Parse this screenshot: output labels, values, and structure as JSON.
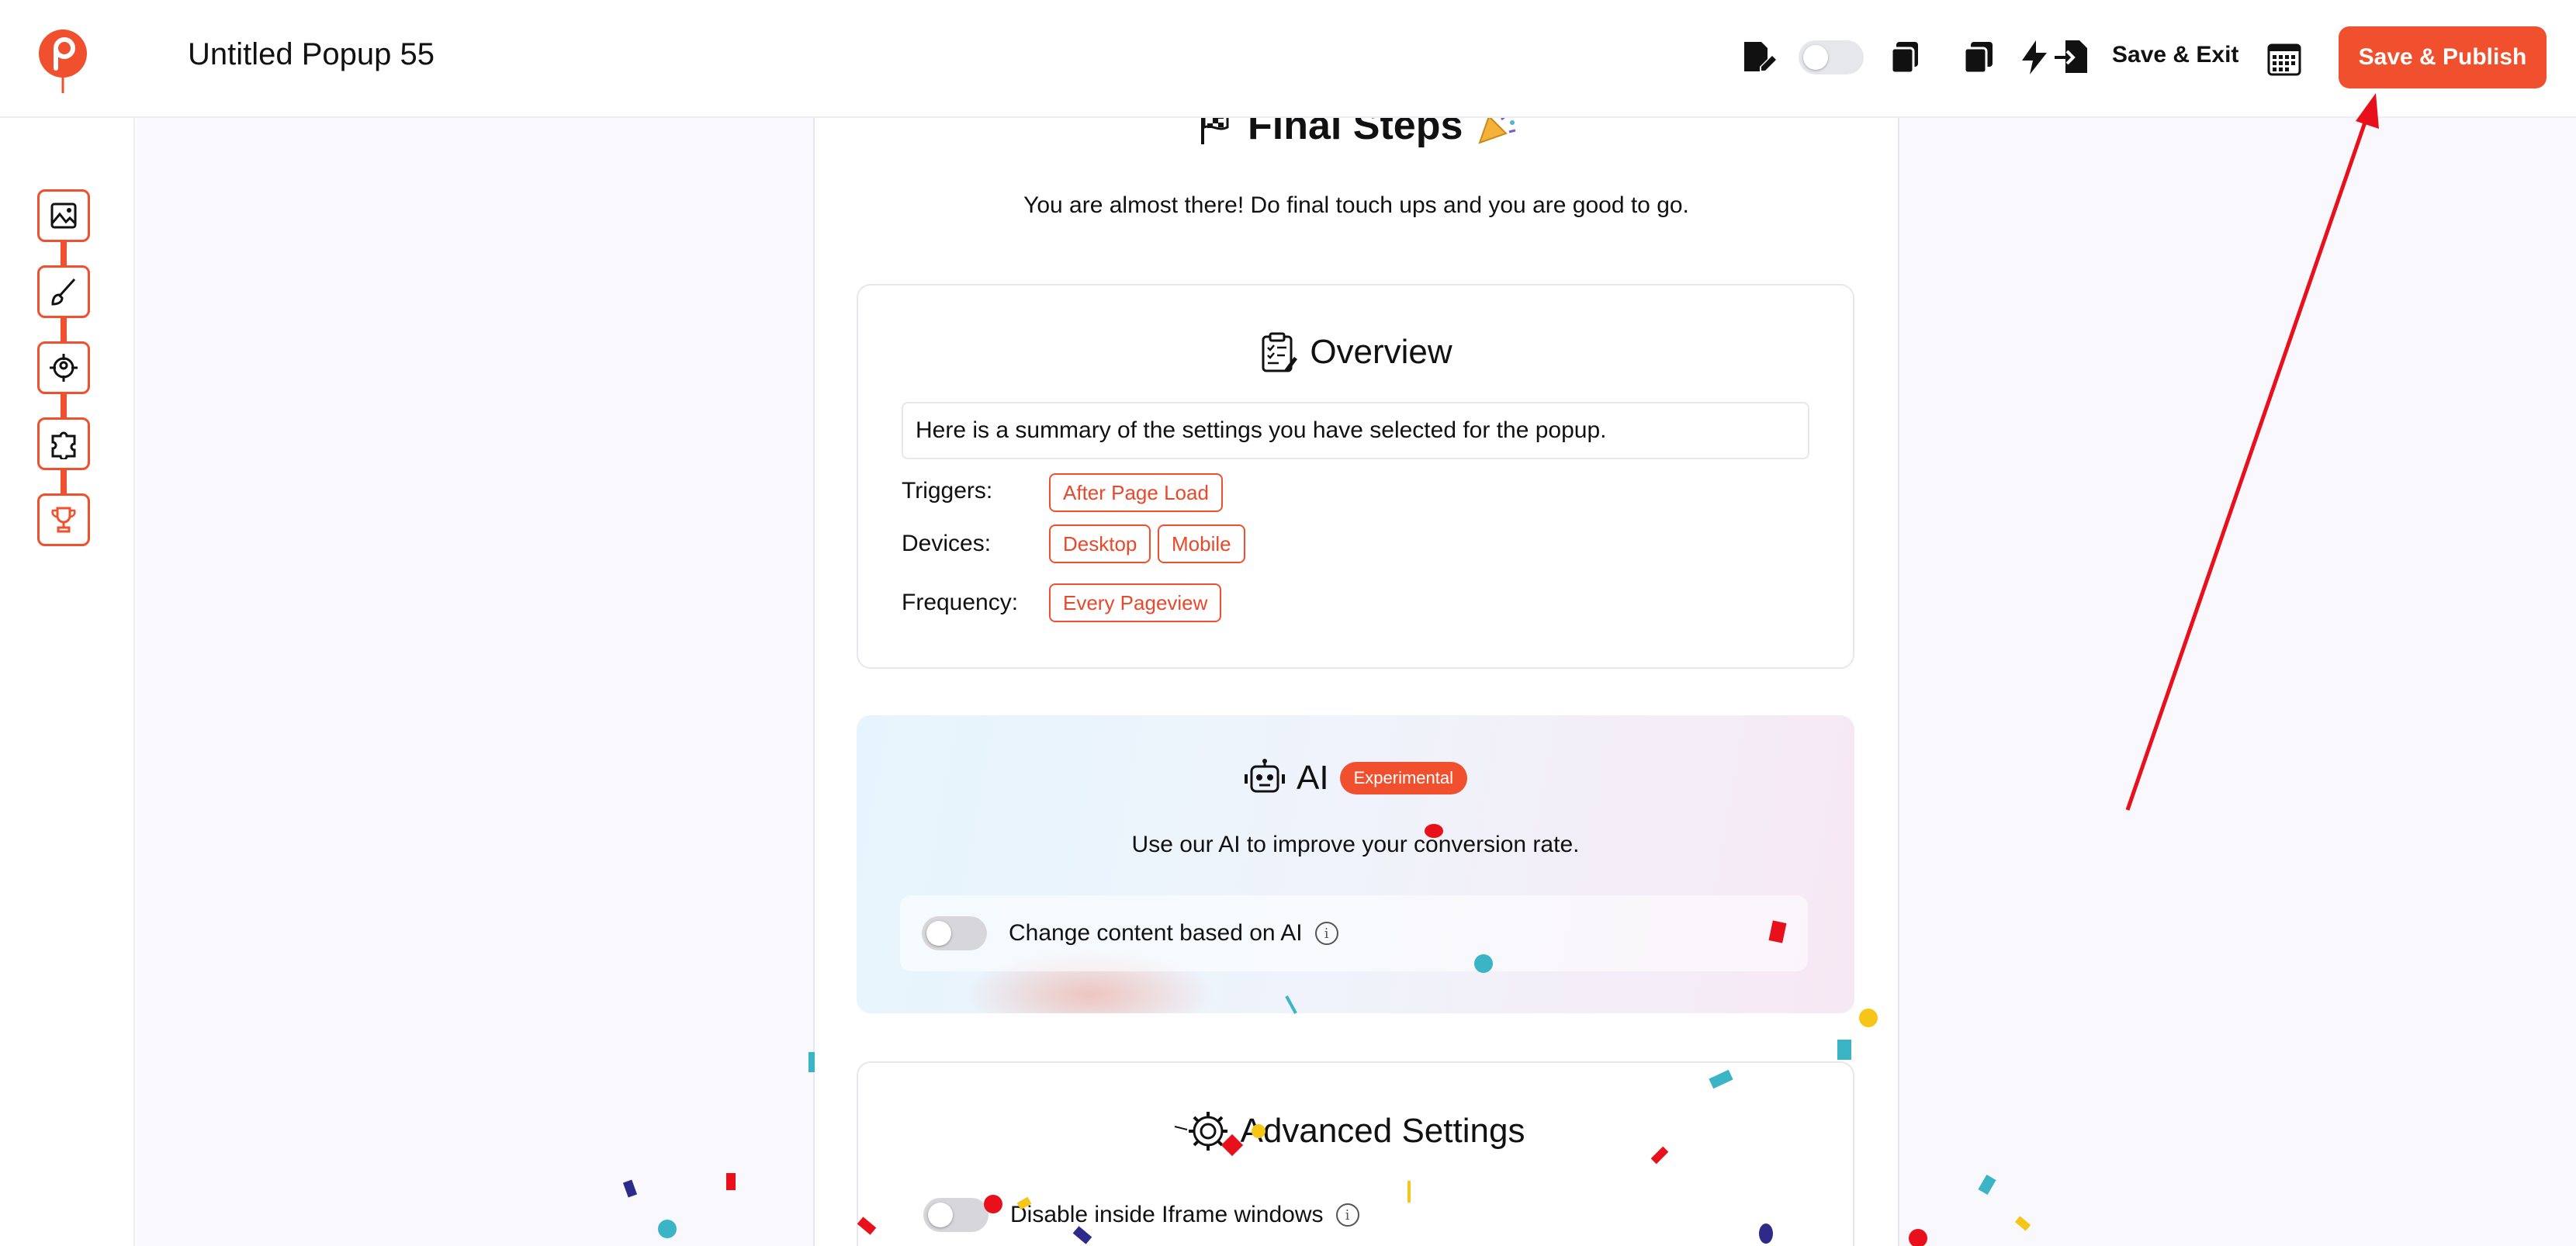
{
  "app": {
    "title": "Untitled Popup 55",
    "save_exit_label": "Save & Exit",
    "publish_label": "Save & Publish",
    "accent": "#f0502d"
  },
  "toolbar_icons": [
    "edit-note-icon",
    "preview-toggle",
    "copy-icon",
    "duplicate-icon",
    "lightning-icon",
    "export-icon",
    "calendar-icon"
  ],
  "sidebar": {
    "steps": [
      {
        "icon": "image-icon"
      },
      {
        "icon": "brush-icon"
      },
      {
        "icon": "target-icon"
      },
      {
        "icon": "puzzle-icon"
      },
      {
        "icon": "trophy-icon"
      }
    ]
  },
  "main": {
    "heading": "Final Steps",
    "subtext": "You are almost there! Do final touch ups and you are good to go.",
    "overview": {
      "title": "Overview",
      "summary": "Here is a summary of the settings you have selected for the popup.",
      "triggers_label": "Triggers:",
      "triggers": [
        "After Page Load"
      ],
      "devices_label": "Devices:",
      "devices": [
        "Desktop",
        "Mobile"
      ],
      "frequency_label": "Frequency:",
      "frequency": [
        "Every Pageview"
      ]
    },
    "ai": {
      "title": "AI",
      "badge": "Experimental",
      "description": "Use our AI to improve your conversion rate.",
      "toggle_label": "Change content based on AI",
      "toggle_on": false
    },
    "advanced": {
      "title": "Advanced Settings",
      "iframe_label": "Disable inside Iframe windows",
      "iframe_on": false
    }
  }
}
